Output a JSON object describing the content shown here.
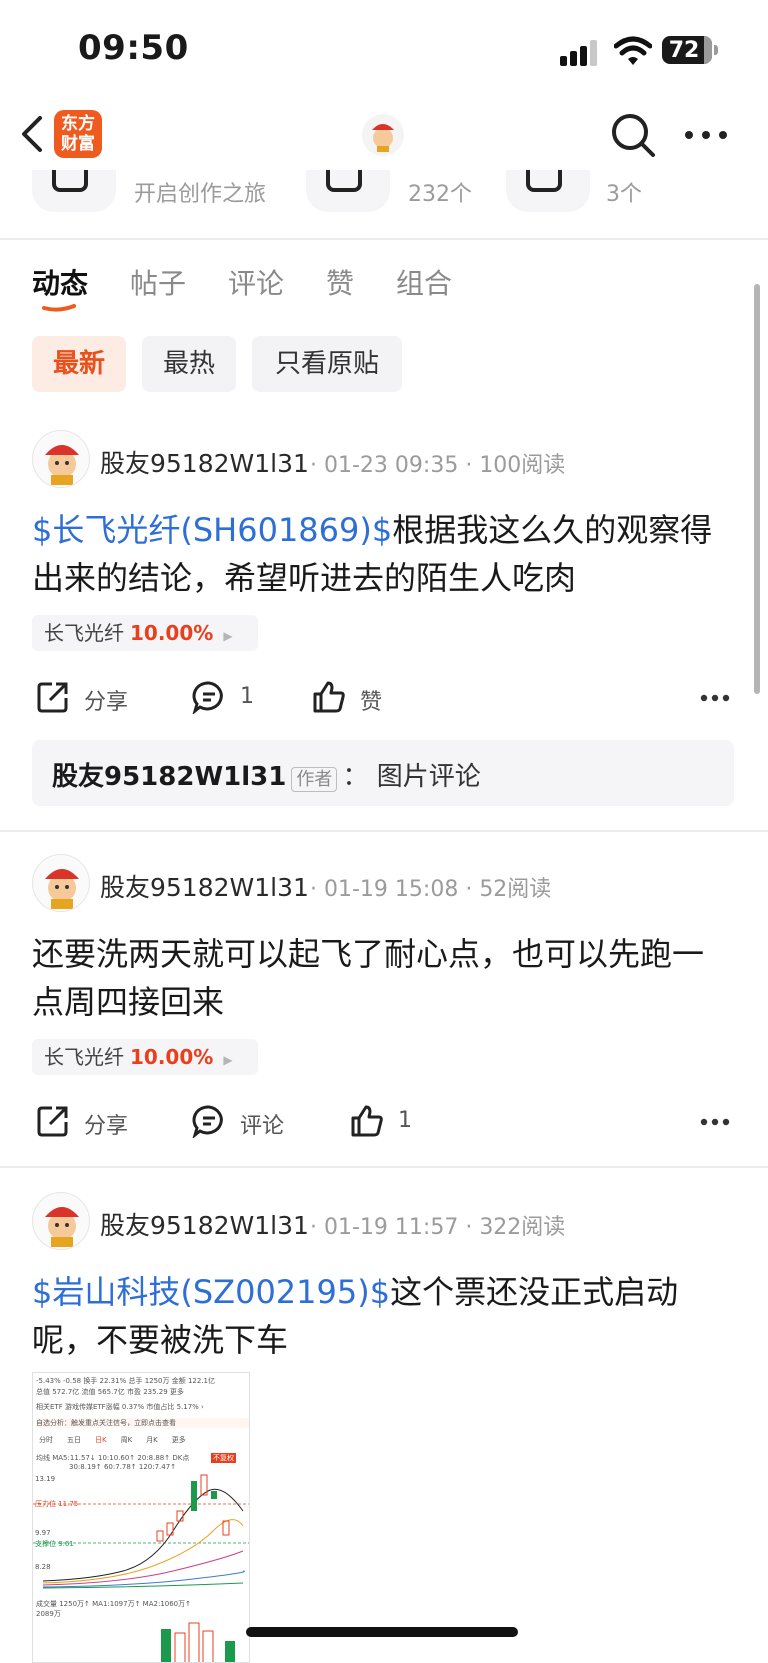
{
  "status": {
    "time": "09:50",
    "battery": "72"
  },
  "nav": {
    "logo_line1": "东方",
    "logo_line2": "财富"
  },
  "stats": {
    "create_label": "开启创作之旅",
    "count_a": "232个",
    "count_b": "3个"
  },
  "tabs": [
    {
      "label": "动态",
      "active": true
    },
    {
      "label": "帖子"
    },
    {
      "label": "评论"
    },
    {
      "label": "赞"
    },
    {
      "label": "组合"
    }
  ],
  "filters": [
    {
      "label": "最新",
      "active": true
    },
    {
      "label": "最热"
    },
    {
      "label": "只看原贴"
    }
  ],
  "posts": [
    {
      "user": "股友95182W1l31",
      "time": "01-23 09:35",
      "reads": "100阅读",
      "link_text": "$长飞光纤(SH601869)$",
      "text_line1_rest": "根据我这么久的观察得",
      "text_line2": "出来的结论，希望听进去的陌生人吃肉",
      "stock_name": "长飞光纤",
      "stock_pct": "10.00%",
      "share_label": "分享",
      "comment_label": "1",
      "like_label": "赞",
      "reply": {
        "user": "股友95182W1l31",
        "badge": "作者",
        "text": "：  图片评论"
      }
    },
    {
      "user": "股友95182W1l31",
      "time": "01-19 15:08",
      "reads": "52阅读",
      "text_line1": "还要洗两天就可以起飞了耐心点，也可以先跑一",
      "text_line2": "点周四接回来",
      "stock_name": "长飞光纤",
      "stock_pct": "10.00%",
      "share_label": "分享",
      "comment_label": "评论",
      "like_label": "1"
    },
    {
      "user": "股友95182W1l31",
      "time": "01-19 11:57",
      "reads": "322阅读",
      "link_text": "$岩山科技(SZ002195)$",
      "text_line1_rest": "这个票还没正式启动",
      "text_line2": "呢，不要被洗下车"
    }
  ],
  "thumbnail": {
    "row1": "-5.43%  -0.58   换手 22.31%  总手 1250万  金额 122.1亿",
    "row2": "总值 572.7亿  流值 565.7亿  市盈 235.29   更多",
    "row3": "相关ETF  游戏传媒ETF涨幅 0.37%        市值占比 5.17% ›",
    "row4": "自选分析：触发重点关注信号，立即点击查看",
    "periods": [
      "分时",
      "五日",
      "日K",
      "周K",
      "月K",
      "更多"
    ],
    "row6": "均线   MA5:11.57↓  10:10.60↑  20:8.88↑   DK点",
    "row7": "30:8.19↑  60:7.78↑  120:7.47↑",
    "badge": "不复权",
    "price_top": "13.19",
    "price_resist": "压力位 11.75",
    "price_mid": "9.97",
    "price_support": "支撑位 9.61",
    "price_low": "8.28",
    "vol_label": "成交量  1250万↑  MA1:1097万↑   MA2:1060万↑",
    "vol_val": "2089万"
  }
}
